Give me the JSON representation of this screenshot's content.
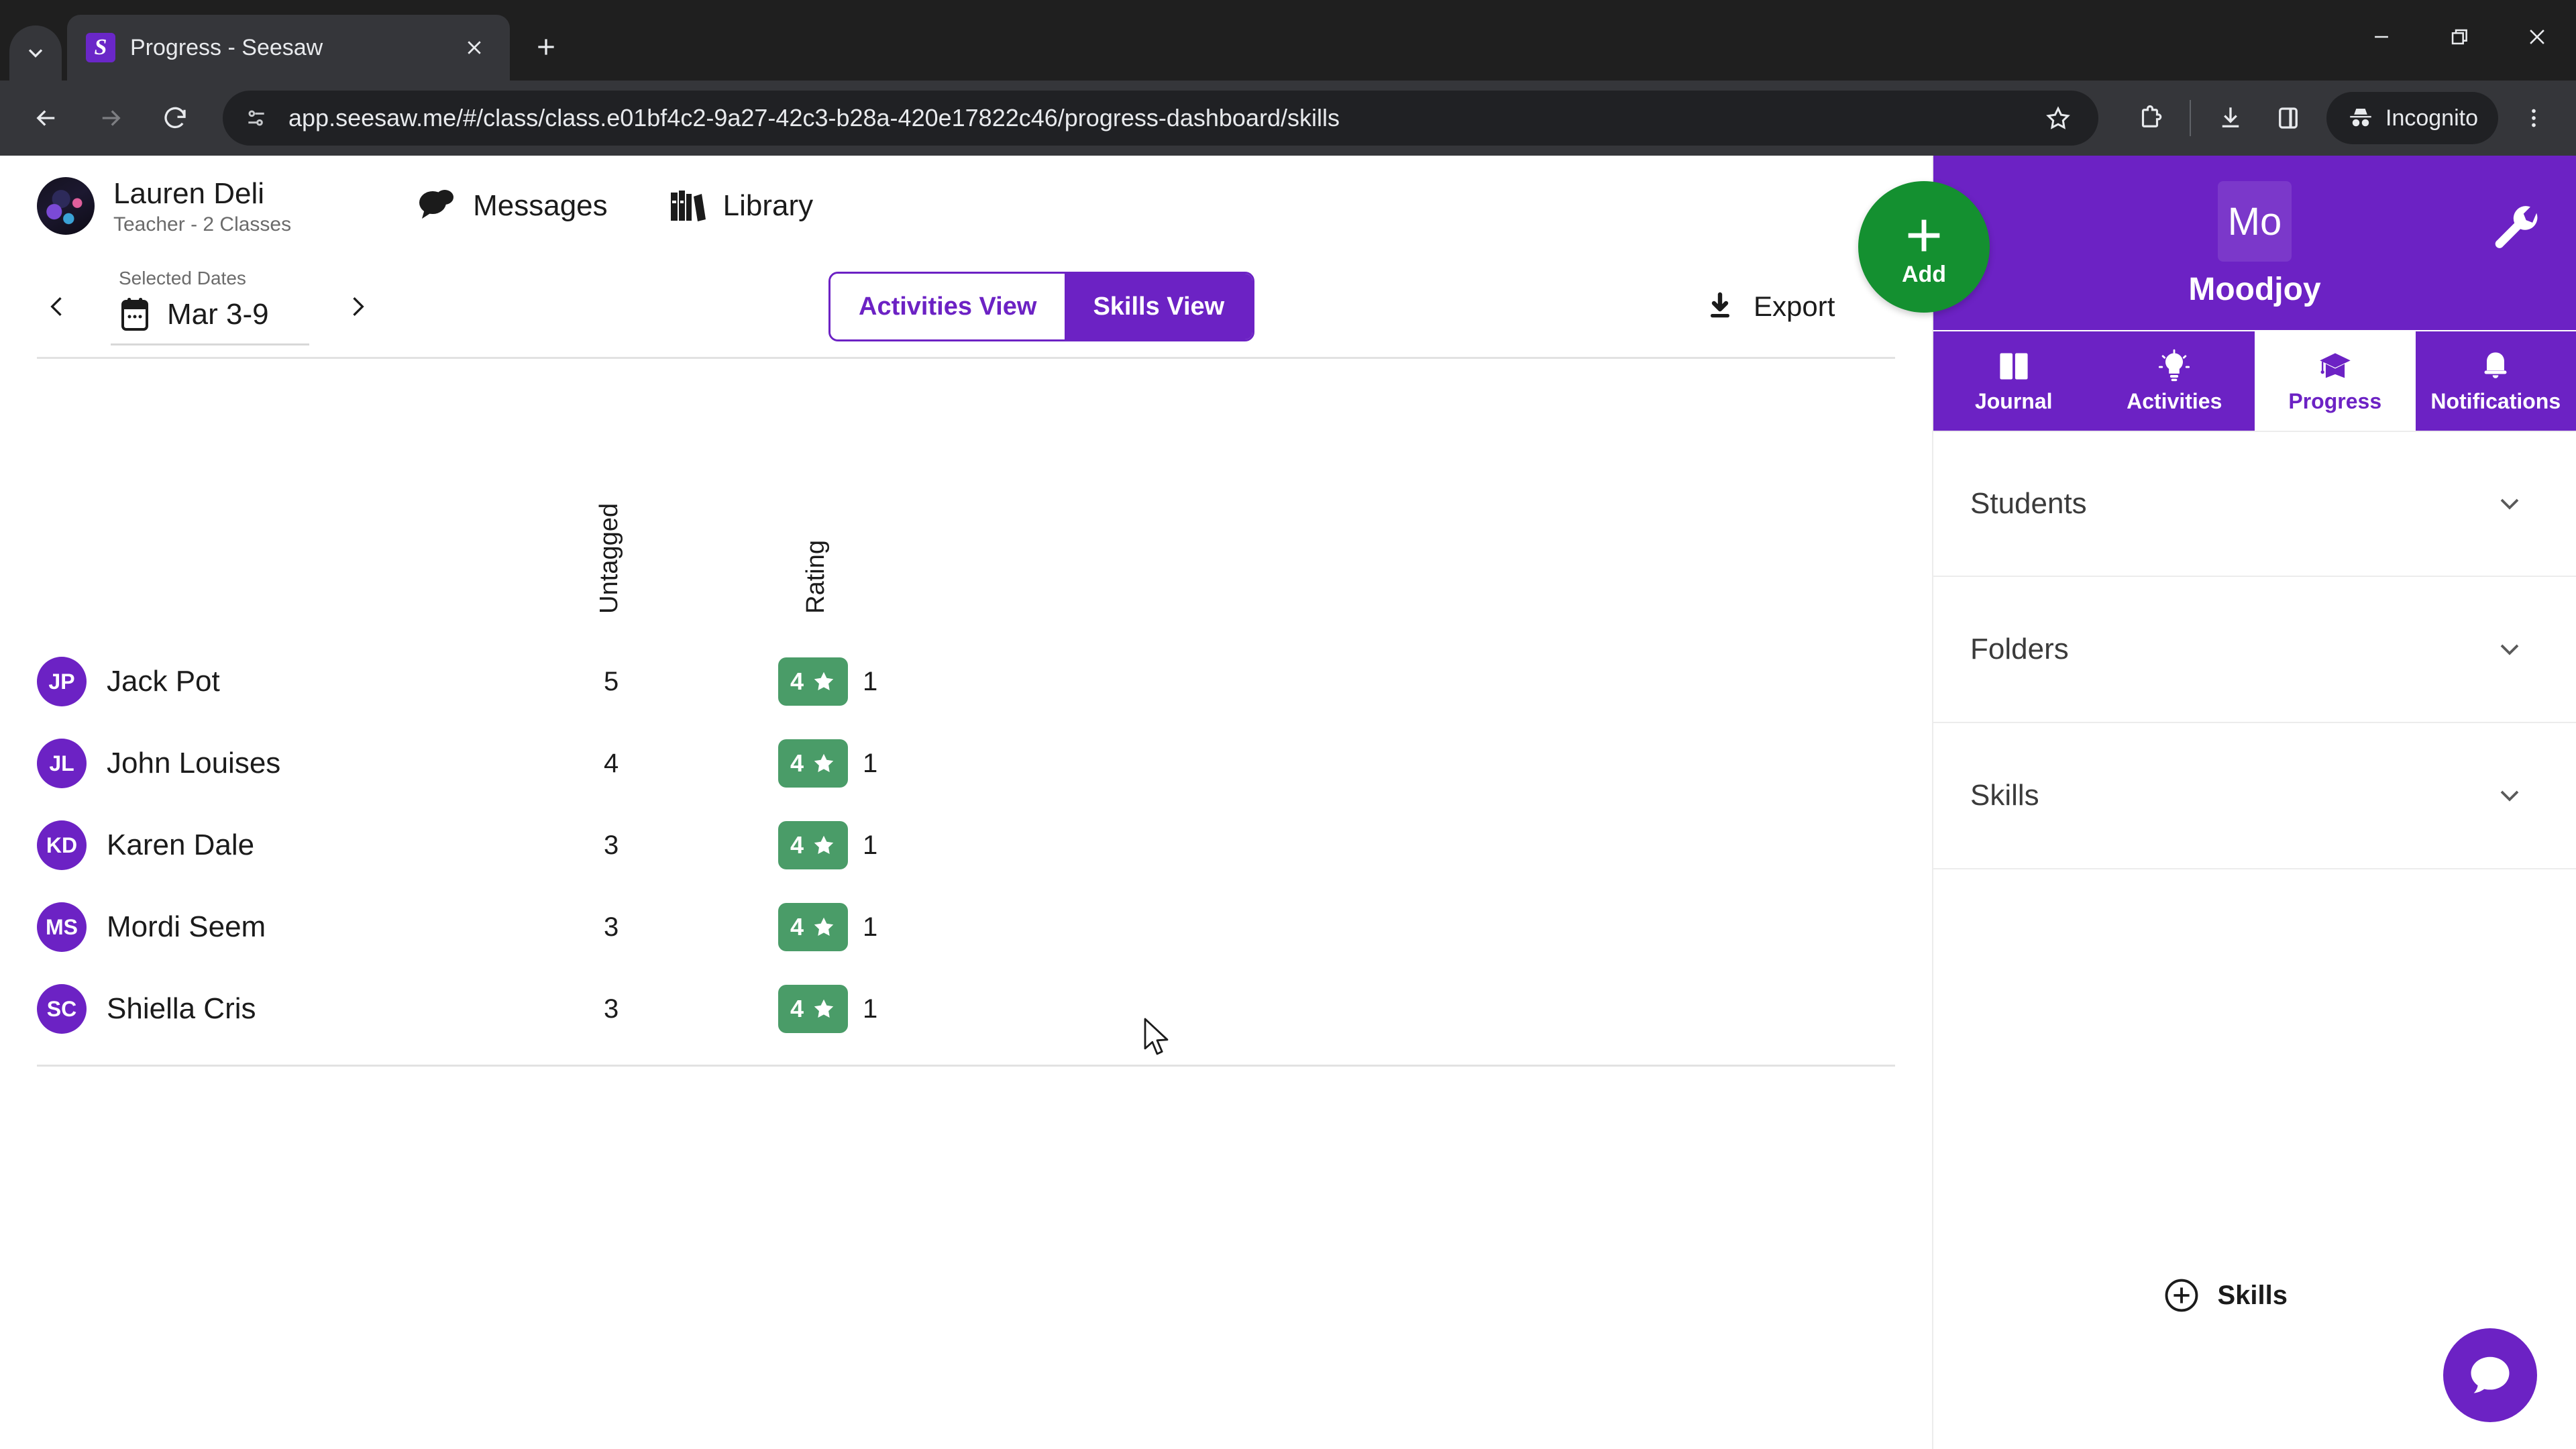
{
  "browser": {
    "tab": {
      "title": "Progress - Seesaw",
      "favicon_letter": "S"
    },
    "new_tab_tooltip": "New Tab",
    "url": "app.seesaw.me/#/class/class.e01bf4c2-9a27-42c3-b28a-420e17822c46/progress-dashboard/skills",
    "profile_label": "Incognito",
    "icons": {
      "tab_list": "chevron-down-icon",
      "close_tab": "close-icon",
      "new_tab": "plus-icon",
      "back": "back-arrow-icon",
      "forward": "forward-arrow-icon",
      "reload": "reload-icon",
      "site_info": "site-settings-icon",
      "bookmark": "star-icon",
      "extensions": "extensions-icon",
      "downloads": "download-icon",
      "side_panel": "side-panel-icon",
      "incognito": "incognito-icon",
      "menu": "kebab-menu-icon",
      "minimize": "minimize-icon",
      "maximize": "maximize-icon",
      "close_window": "close-window-icon"
    },
    "accent": "#6a27c8"
  },
  "app_header": {
    "user_name": "Lauren Deli",
    "user_role": "Teacher - 2 Classes",
    "links": [
      {
        "label": "Messages",
        "icon": "messages-icon"
      },
      {
        "label": "Library",
        "icon": "library-icon"
      }
    ]
  },
  "controls": {
    "selected_dates_label": "Selected Dates",
    "selected_dates_value": "Mar 3-9",
    "prev_icon": "chevron-left-icon",
    "next_icon": "chevron-right-icon",
    "calendar_icon": "calendar-icon",
    "views": [
      {
        "label": "Activities View",
        "active": false
      },
      {
        "label": "Skills View",
        "active": true
      }
    ],
    "export_label": "Export",
    "export_icon": "download-icon"
  },
  "table": {
    "columns": [
      "Untagged",
      "Rating"
    ],
    "rows": [
      {
        "initials": "JP",
        "name": "Jack Pot",
        "untagged": "5",
        "rating_value": "4",
        "rating_count": "1"
      },
      {
        "initials": "JL",
        "name": "John Louises",
        "untagged": "4",
        "rating_value": "4",
        "rating_count": "1"
      },
      {
        "initials": "KD",
        "name": "Karen Dale",
        "untagged": "3",
        "rating_value": "4",
        "rating_count": "1"
      },
      {
        "initials": "MS",
        "name": "Mordi Seem",
        "untagged": "3",
        "rating_value": "4",
        "rating_count": "1"
      },
      {
        "initials": "SC",
        "name": "Shiella Cris",
        "untagged": "3",
        "rating_value": "4",
        "rating_count": "1"
      }
    ]
  },
  "sidebar": {
    "class_initials": "Mo",
    "class_name": "Moodjoy",
    "settings_icon": "wrench-icon",
    "add_button": {
      "label": "Add",
      "icon": "plus-icon",
      "color": "#149030"
    },
    "tabs": [
      {
        "label": "Journal",
        "icon": "journal-icon",
        "active": false
      },
      {
        "label": "Activities",
        "icon": "lightbulb-icon",
        "active": false
      },
      {
        "label": "Progress",
        "icon": "graduation-cap-icon",
        "active": true
      },
      {
        "label": "Notifications",
        "icon": "bell-icon",
        "active": false
      }
    ],
    "accordion": [
      {
        "label": "Students",
        "icon": "chevron-down-icon"
      },
      {
        "label": "Folders",
        "icon": "chevron-down-icon"
      },
      {
        "label": "Skills",
        "icon": "chevron-down-icon"
      }
    ],
    "add_skills": {
      "label": "Skills",
      "icon": "plus-circle-icon"
    },
    "chat": {
      "icon": "chat-bubble-icon",
      "color": "#6c22c4"
    }
  },
  "colors": {
    "brand_purple": "#6c22c4",
    "rating_green": "#4a9c68",
    "add_green": "#149030"
  }
}
